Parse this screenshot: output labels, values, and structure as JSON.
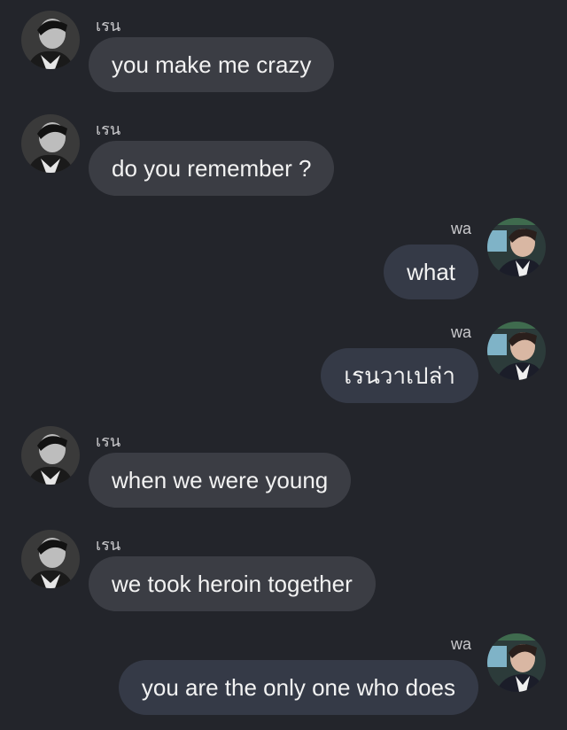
{
  "colors": {
    "background": "#23252b",
    "bubble_received": "#3b3d44",
    "bubble_sent": "#353a47",
    "text": "#f2f2f2",
    "name_text": "#c9c9cc"
  },
  "messages": [
    {
      "side": "left",
      "sender": "เรน",
      "text": "you make me crazy",
      "avatar_icon": "profile-photo-bw"
    },
    {
      "side": "left",
      "sender": "เรน",
      "text": "do you remember ?",
      "avatar_icon": "profile-photo-bw"
    },
    {
      "side": "right",
      "sender": "wa",
      "text": "what",
      "avatar_icon": "profile-photo-color"
    },
    {
      "side": "right",
      "sender": "wa",
      "text": "เรนวาเปล่า",
      "avatar_icon": "profile-photo-color"
    },
    {
      "side": "left",
      "sender": "เรน",
      "text": "when we were young",
      "avatar_icon": "profile-photo-bw"
    },
    {
      "side": "left",
      "sender": "เรน",
      "text": "we took heroin together",
      "avatar_icon": "profile-photo-bw"
    },
    {
      "side": "right",
      "sender": "wa",
      "text": "you are the only one who does",
      "avatar_icon": "profile-photo-color"
    }
  ]
}
